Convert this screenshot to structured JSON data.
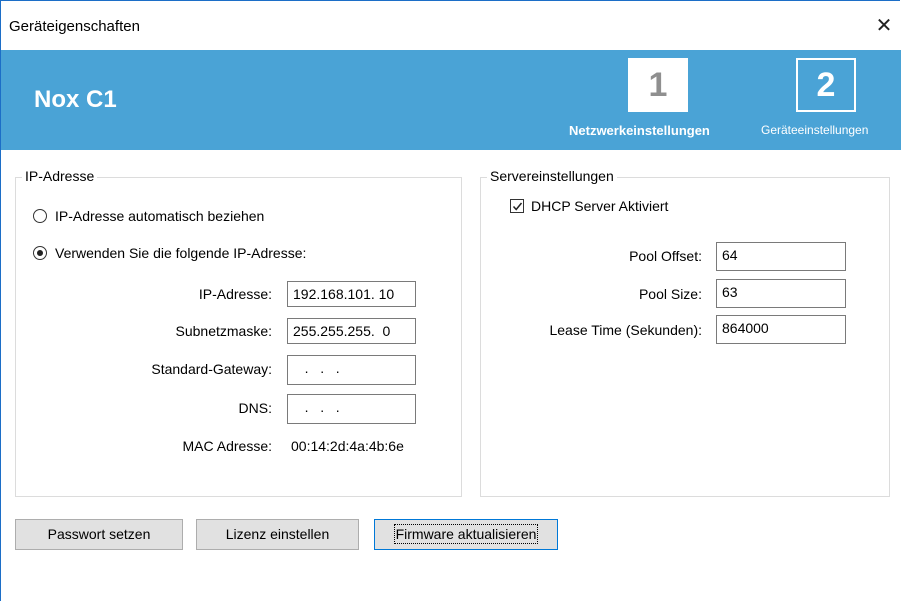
{
  "window": {
    "title": "Geräteigenschaften",
    "close_glyph": "✕"
  },
  "header": {
    "device_name": "Nox C1",
    "steps": [
      {
        "number": "1",
        "label": "Netzwerkeinstellungen"
      },
      {
        "number": "2",
        "label": "Geräteeinstellungen"
      }
    ],
    "background_color": "#4aa3d6"
  },
  "ip_group": {
    "legend": "IP-Adresse",
    "auto_option": "IP-Adresse automatisch beziehen",
    "manual_option": "Verwenden Sie die folgende IP-Adresse:",
    "selected": "manual",
    "fields": {
      "ip_label": "IP-Adresse:",
      "ip_value": "192.168.101. 10",
      "subnet_label": "Subnetzmaske:",
      "subnet_value": "255.255.255.  0",
      "gateway_label": "Standard-Gateway:",
      "gateway_value": "   .   .   .",
      "dns_label": "DNS:",
      "dns_value": "   .   .   .",
      "mac_label": "MAC Adresse:",
      "mac_value": "00:14:2d:4a:4b:6e"
    }
  },
  "server_group": {
    "legend": "Servereinstellungen",
    "dhcp_label": "DHCP Server Aktiviert",
    "dhcp_checked": true,
    "pool_offset_label": "Pool Offset:",
    "pool_offset_value": "64",
    "pool_size_label": "Pool Size:",
    "pool_size_value": "63",
    "lease_time_label": "Lease Time (Sekunden):",
    "lease_time_value": "864000"
  },
  "buttons": {
    "password": "Passwort setzen",
    "license": "Lizenz einstellen",
    "firmware": "Firmware aktualisieren"
  }
}
